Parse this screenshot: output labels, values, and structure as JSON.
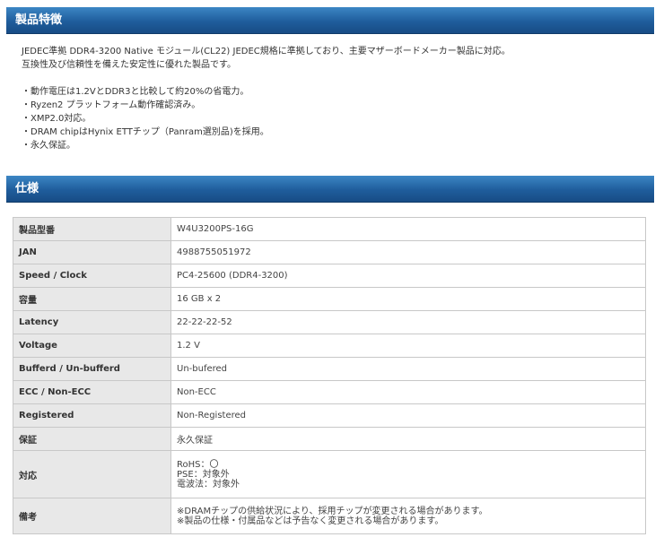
{
  "sections": {
    "features_title": "製品特徴",
    "specs_title": "仕様"
  },
  "features": {
    "intro_1": "JEDEC準拠 DDR4-3200 Native モジュール(CL22) JEDEC規格に準拠しており、主要マザーボードメーカー製品に対応。",
    "intro_2": "互換性及び信頼性を備えた安定性に優れた製品です。",
    "bullets": [
      "・動作電圧は1.2VとDDR3と比較して約20%の省電力。",
      "・Ryzen2 プラットフォーム動作確認済み。",
      "・XMP2.0対応。",
      "・DRAM chipはHynix ETTチップ（Panram選別品)を採用。",
      "・永久保証。"
    ]
  },
  "specs": [
    {
      "key": "製品型番",
      "value": "W4U3200PS-16G"
    },
    {
      "key": "JAN",
      "value": "4988755051972"
    },
    {
      "key": "Speed / Clock",
      "value": "PC4-25600 (DDR4-3200)"
    },
    {
      "key": "容量",
      "value": "16 GB x 2"
    },
    {
      "key": "Latency",
      "value": "22-22-22-52"
    },
    {
      "key": "Voltage",
      "value": "1.2 V"
    },
    {
      "key": "Bufferd / Un-bufferd",
      "value": "Un-bufered"
    },
    {
      "key": "ECC / Non-ECC",
      "value": "Non-ECC"
    },
    {
      "key": "Registered",
      "value": "Non-Registered"
    },
    {
      "key": "保証",
      "value": "永久保証"
    },
    {
      "key": "対応",
      "lines": [
        "RoHS：〇",
        "PSE：対象外",
        "電波法：対象外"
      ]
    },
    {
      "key": "備考",
      "lines": [
        "※DRAMチップの供給状況により、採用チップが変更される場合があります。",
        "※製品の仕様・付属品などは予告なく変更される場合があります。"
      ]
    }
  ]
}
